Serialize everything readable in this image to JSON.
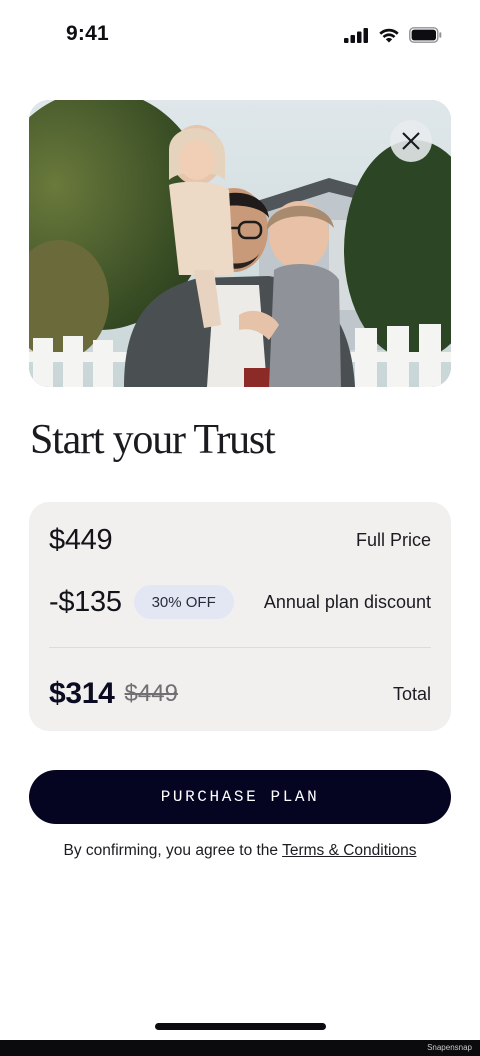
{
  "status_bar": {
    "time": "9:41",
    "icons": [
      "cellular-signal-icon",
      "wifi-icon",
      "battery-icon"
    ]
  },
  "hero": {
    "image": "family-photo",
    "close_icon": "close-icon"
  },
  "title": "Start your Trust",
  "pricing": {
    "full_price_amount": "$449",
    "full_price_label": "Full Price",
    "discount_amount": "-$135",
    "discount_badge": "30% OFF",
    "discount_label": "Annual plan discount",
    "total_amount": "$314",
    "original_amount": "$449",
    "total_label": "Total"
  },
  "purchase_button_label": "PURCHASE PLAN",
  "terms": {
    "prefix": "By confirming, you agree to the ",
    "link": "Terms & Conditions"
  },
  "watermark": "Snapensnap",
  "colors": {
    "button_background": "#050522",
    "card_background": "#f1f0ee",
    "badge_background": "#e3e7f4"
  }
}
